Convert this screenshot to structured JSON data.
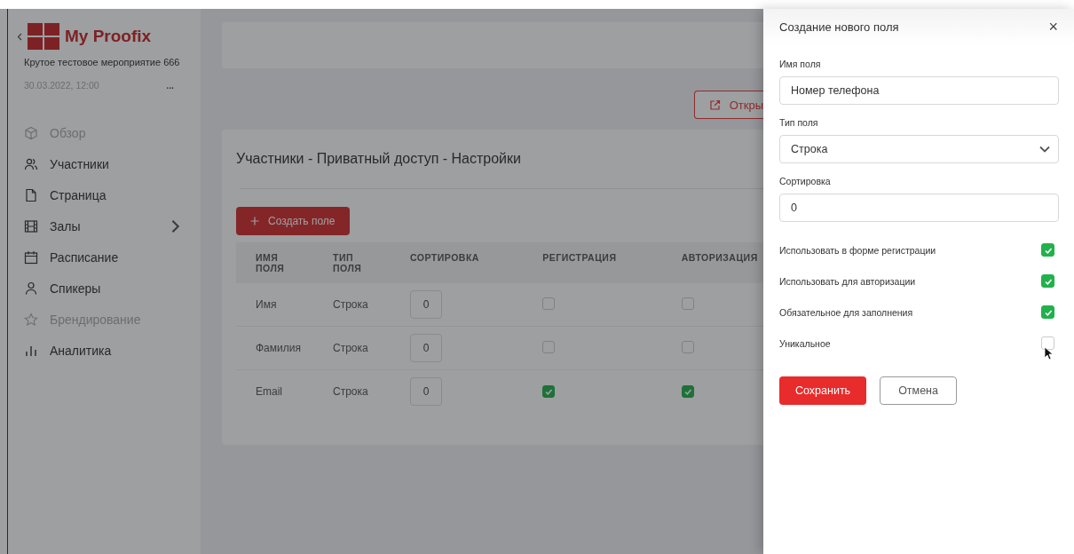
{
  "sidebar": {
    "brand": "My Proofix",
    "event_name": "Крутое тестовое мероприятие 666",
    "event_date": "30.03.2022, 12:00",
    "more": "...",
    "items": [
      {
        "label": "Обзор",
        "disabled": true,
        "has_submenu": false
      },
      {
        "label": "Участники",
        "disabled": false,
        "has_submenu": false
      },
      {
        "label": "Страница",
        "disabled": false,
        "has_submenu": false
      },
      {
        "label": "Залы",
        "disabled": false,
        "has_submenu": true
      },
      {
        "label": "Расписание",
        "disabled": false,
        "has_submenu": false
      },
      {
        "label": "Спикеры",
        "disabled": false,
        "has_submenu": false
      },
      {
        "label": "Брендирование",
        "disabled": true,
        "has_submenu": false
      },
      {
        "label": "Аналитика",
        "disabled": false,
        "has_submenu": false
      }
    ]
  },
  "open_button": "Откры",
  "card": {
    "title": "Участники - Приватный доступ - Настройки",
    "create_button": "Создать поле",
    "table": {
      "columns": [
        "ИМЯ ПОЛЯ",
        "ТИП ПОЛЯ",
        "СОРТИРОВКА",
        "РЕГИСТРАЦИЯ",
        "АВТОРИЗАЦИЯ"
      ],
      "rows": [
        {
          "name": "Имя",
          "type": "Строка",
          "sort": "0",
          "registration": false,
          "authorization": false
        },
        {
          "name": "Фамилия",
          "type": "Строка",
          "sort": "0",
          "registration": false,
          "authorization": false
        },
        {
          "name": "Email",
          "type": "Строка",
          "sort": "0",
          "registration": true,
          "authorization": true
        }
      ]
    }
  },
  "panel": {
    "title": "Создание нового поля",
    "close": "×",
    "fields": [
      {
        "kind": "input",
        "label": "Имя поля",
        "value": "Номер телефона"
      },
      {
        "kind": "select",
        "label": "Тип поля",
        "value": "Строка"
      },
      {
        "kind": "input",
        "label": "Сортировка",
        "value": "0"
      }
    ],
    "options": [
      {
        "label": "Использовать в форме регистрации",
        "checked": true
      },
      {
        "label": "Использовать для авторизации",
        "checked": true
      },
      {
        "label": "Обязательное для заполнения",
        "checked": true
      },
      {
        "label": "Уникальное",
        "checked": false
      }
    ],
    "buttons": [
      {
        "kind": "primary",
        "label": "Сохранить"
      },
      {
        "kind": "secondary",
        "label": "Отмена"
      }
    ]
  }
}
